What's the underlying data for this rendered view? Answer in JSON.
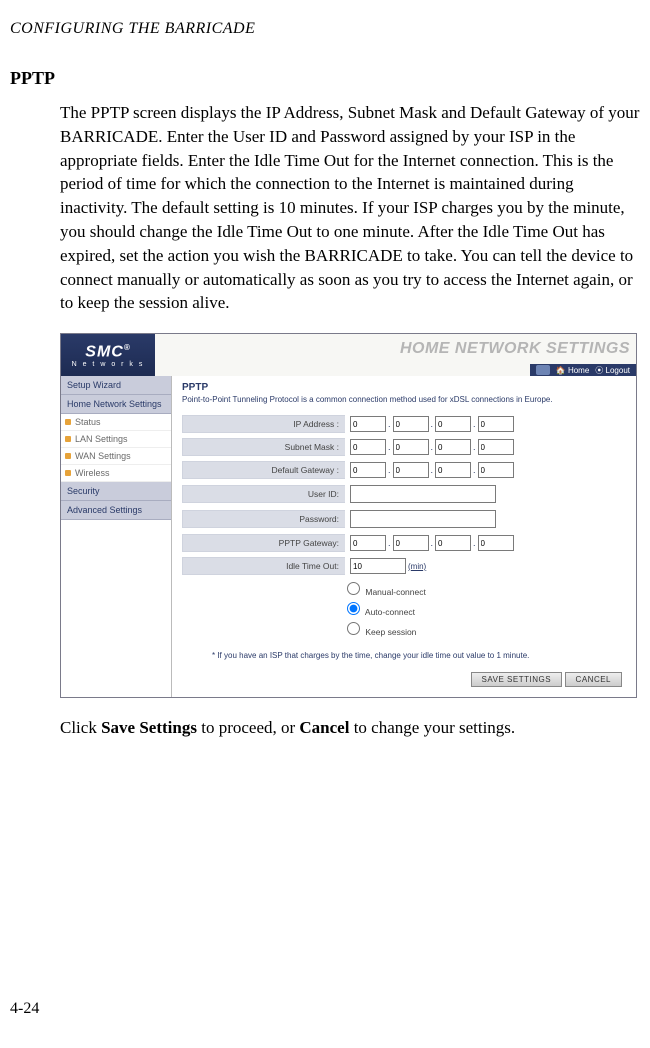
{
  "page": {
    "header": "CONFIGURING THE BARRICADE",
    "num": "4-24"
  },
  "section": {
    "title": "PPTP",
    "para1": "The PPTP screen displays the IP Address, Subnet Mask and Default Gateway of your BARRICADE. Enter the User ID and Password assigned by your ISP in the appropriate fields. Enter the Idle Time Out for the Internet connection. This is the period of time for which the connection to the Internet is maintained during inactivity. The default setting is 10 minutes. If your ISP charges you by the minute, you should change the Idle Time Out to one minute. After the Idle Time Out has expired, set the action you wish the BARRICADE to take. You can tell the device to connect manually or automatically as soon as you try to access the Internet again, or to keep the session alive.",
    "para2_a": "Click ",
    "para2_b": "Save Settings",
    "para2_c": " to proceed, or ",
    "para2_d": "Cancel",
    "para2_e": " to change your settings."
  },
  "ui": {
    "brand_name": "SMC",
    "brand_sub": "N e t w o r k s",
    "banner_title": "HOME NETWORK SETTINGS",
    "nav_home": "Home",
    "nav_logout": "Logout",
    "sidebar": {
      "setup": "Setup Wizard",
      "home": "Home Network Settings",
      "status": "Status",
      "lan": "LAN Settings",
      "wan": "WAN Settings",
      "wireless": "Wireless",
      "security": "Security",
      "advanced": "Advanced Settings"
    },
    "content": {
      "title": "PPTP",
      "desc": "Point-to-Point Tunneling Protocol is a common connection method used for xDSL connections in Europe.",
      "labels": {
        "ip": "IP Address :",
        "subnet": "Subnet Mask :",
        "gw": "Default Gateway :",
        "user": "User ID:",
        "pass": "Password:",
        "pptp_gw": "PPTP Gateway:",
        "idle": "Idle Time Out:"
      },
      "ip": [
        "0",
        "0",
        "0",
        "0"
      ],
      "subnet": [
        "0",
        "0",
        "0",
        "0"
      ],
      "gw": [
        "0",
        "0",
        "0",
        "0"
      ],
      "pptp_gw": [
        "0",
        "0",
        "0",
        "0"
      ],
      "idle_value": "10",
      "idle_unit": "(min)",
      "radios": {
        "manual": "Manual-connect",
        "auto": "Auto-connect",
        "keep": "Keep session"
      },
      "hint": "*  If you have an ISP that charges by the time, change your idle time out value to 1 minute.",
      "btn_save": "SAVE SETTINGS",
      "btn_cancel": "CANCEL"
    }
  }
}
